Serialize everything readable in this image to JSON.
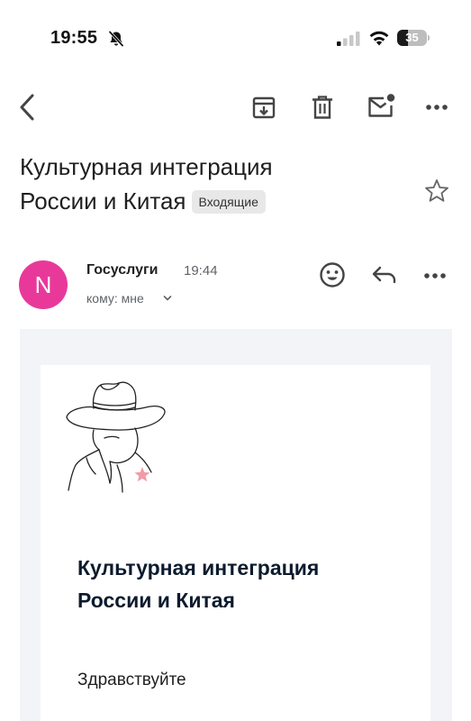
{
  "status_bar": {
    "time": "19:55",
    "battery_percent": 35,
    "battery_label": "35",
    "icons": [
      "bell-muted-icon",
      "cellular-signal-icon",
      "wifi-icon",
      "battery-icon"
    ]
  },
  "toolbar": {
    "icons": [
      "back-chevron-icon",
      "archive-icon",
      "trash-icon",
      "mark-unread-icon",
      "more-horizontal-icon"
    ]
  },
  "email": {
    "subject_line1": "Культурная интеграция",
    "subject_line2": "России и Китая",
    "label": "Входящие",
    "starred": false
  },
  "sender": {
    "avatar_letter": "N",
    "avatar_color": "#e8399b",
    "name": "Госуслуги",
    "time": "19:44",
    "recipient": "кому: мне"
  },
  "body": {
    "title_line1": "Культурная интеграция",
    "title_line2": "России и Китая",
    "greeting": "Здравствуйте",
    "title_color": "#0d1b2e",
    "background_color": "#f2f4f7",
    "accent_star_color": "#f39aa6"
  }
}
